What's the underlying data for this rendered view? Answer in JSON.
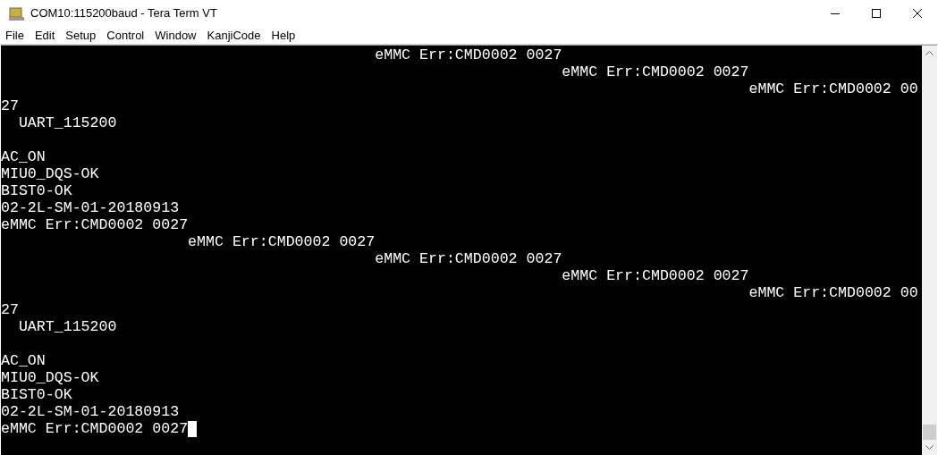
{
  "window": {
    "title": "COM10:115200baud - Tera Term VT"
  },
  "menu": [
    "File",
    "Edit",
    "Setup",
    "Control",
    "Window",
    "KanjiCode",
    "Help"
  ],
  "terminal": {
    "lines": [
      {
        "text": "                                          eMMC Err:CMD0002 0027"
      },
      {
        "text": "                                                               eMMC Err:CMD0002 0027"
      },
      {
        "text": "                                                                                    eMMC Err:CMD0002 00"
      },
      {
        "text": "27"
      },
      {
        "text": "  UART_115200",
        "blank_after": true
      },
      {
        "text": "AC_ON"
      },
      {
        "text": "MIU0_DQS-OK"
      },
      {
        "text": "BIST0-OK"
      },
      {
        "text": "02-2L-SM-01-20180913"
      },
      {
        "text": "eMMC Err:CMD0002 0027"
      },
      {
        "text": "                     eMMC Err:CMD0002 0027"
      },
      {
        "text": "                                          eMMC Err:CMD0002 0027"
      },
      {
        "text": "                                                               eMMC Err:CMD0002 0027"
      },
      {
        "text": "                                                                                    eMMC Err:CMD0002 00"
      },
      {
        "text": "27"
      },
      {
        "text": "  UART_115200",
        "blank_after": true
      },
      {
        "text": "AC_ON"
      },
      {
        "text": "MIU0_DQS-OK"
      },
      {
        "text": "BIST0-OK"
      },
      {
        "text": "02-2L-SM-01-20180913"
      },
      {
        "text": "eMMC Err:CMD0002 0027",
        "cursor": true
      }
    ]
  }
}
